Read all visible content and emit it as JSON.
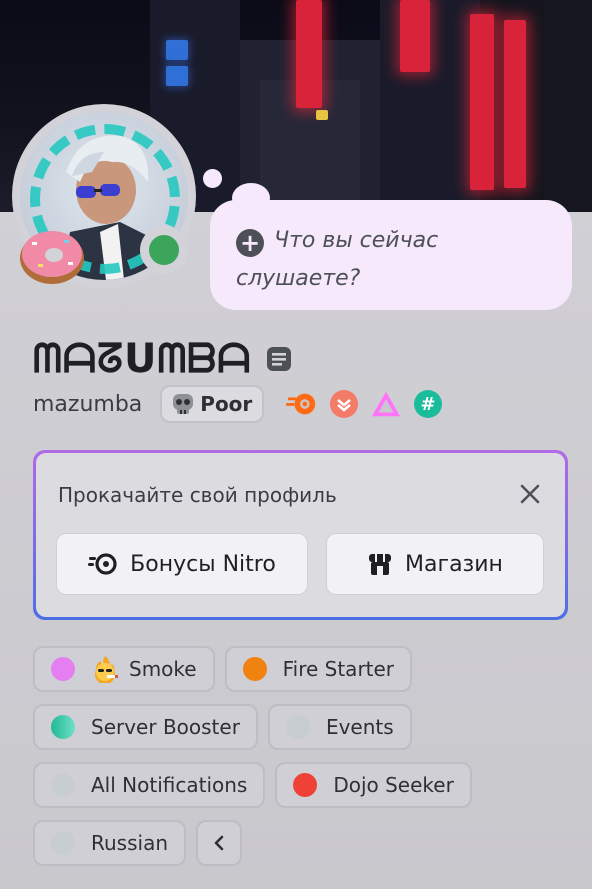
{
  "status_bubble": {
    "placeholder": "Что вы сейчас слушаете?"
  },
  "profile": {
    "display_name": "ᗰᗩᘔᑌᗰᗷᗩ",
    "username": "mazumba",
    "tag_label": "Poor"
  },
  "badges": [
    "nitro-boost-badge",
    "hypesquad-badge",
    "quest-badge",
    "server-tag-badge"
  ],
  "nitro_card": {
    "title": "Прокачайте свой профиль",
    "button_nitro": "Бонусы Nitro",
    "button_shop": "Магазин"
  },
  "roles": [
    {
      "label": "Smoke",
      "color": "#e57ef0",
      "emoji": "smoking-face-emoji"
    },
    {
      "label": "Fire Starter",
      "color": "#f0820f"
    },
    {
      "label": "Server Booster",
      "color": "#2ec8a4"
    },
    {
      "label": "Events",
      "color": "#c7cdd1"
    },
    {
      "label": "All Notifications",
      "color": "#c7cdd1"
    },
    {
      "label": "Dojo Seeker",
      "color": "#ef4135"
    },
    {
      "label": "Russian",
      "color": "#c7cdd1"
    }
  ],
  "colors": {
    "online": "#3ba55c",
    "card_border_top": "#b36ae6",
    "card_border_bottom": "#4d6ee5",
    "bubble": "#f5e9fb"
  }
}
